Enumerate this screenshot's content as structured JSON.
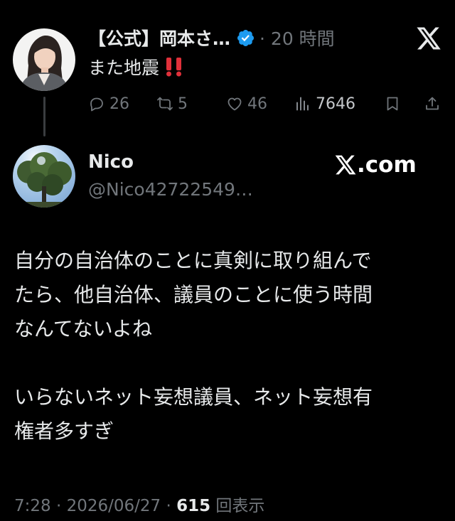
{
  "parent_tweet": {
    "author_name": "【公式】岡本さ…",
    "time": "· 20 時間",
    "text": "また地震",
    "text_emoji": "double-exclamation-icon",
    "stats": {
      "replies": "26",
      "retweets": "5",
      "likes": "46",
      "views": "7646"
    }
  },
  "reply_tweet": {
    "author_name": "Nico",
    "handle": "@Nico42722549…",
    "watermark": ".com",
    "body_paragraph_1": [
      "自分の自治体のことに真剣に取り組んで",
      "たら、他自治体、議員のことに使う時間",
      "なんてないよね"
    ],
    "body_paragraph_2": [
      "いらないネット妄想議員、ネット妄想有",
      "権者多すぎ"
    ],
    "meta": {
      "timestamp": "7:28 · 2026/06/27 · ",
      "views_count": "615",
      "views_label": " 回表示"
    }
  },
  "colors": {
    "background": "#000000",
    "text_primary": "#e7e9ea",
    "text_secondary": "#71767b",
    "verified_blue": "#1d9bf0",
    "emoji_red": "#e0303a"
  }
}
